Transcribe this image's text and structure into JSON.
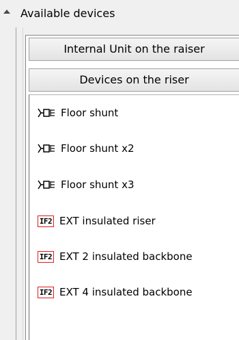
{
  "section": {
    "title": "Available devices",
    "expanded": true
  },
  "categories": [
    {
      "label": "Internal Unit on the raiser"
    },
    {
      "label": "Devices on the riser"
    }
  ],
  "devices": [
    {
      "label": "Floor shunt",
      "icon": "floor-shunt-icon"
    },
    {
      "label": "Floor shunt x2",
      "icon": "floor-shunt-icon"
    },
    {
      "label": "Floor shunt x3",
      "icon": "floor-shunt-icon"
    },
    {
      "label": "EXT insulated riser",
      "icon": "if2-icon",
      "icon_text": "IF2"
    },
    {
      "label": "EXT 2 insulated backbone",
      "icon": "if2-icon",
      "icon_text": "IF2"
    },
    {
      "label": "EXT 4 insulated backbone",
      "icon": "if2-icon",
      "icon_text": "IF2"
    }
  ],
  "colors": {
    "if2_border": "#e01a1a",
    "background": "#f0f0f0",
    "list_background": "#ffffff"
  }
}
